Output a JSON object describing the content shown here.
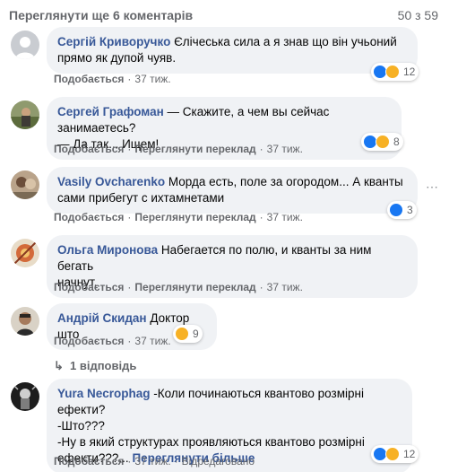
{
  "header": {
    "view_more": "Переглянути ще 6 коментарів",
    "count": "50 з 59"
  },
  "colors": {
    "author": "#385898",
    "bubble": "#f0f2f5",
    "meta": "#65676b",
    "like": "#1877f2",
    "haha": "#f7b125"
  },
  "actions": {
    "like": "Подобається",
    "translate": "Переглянути переклад",
    "week": "37 тиж.",
    "edited": "Відредаговано",
    "see_more": "Переглянути більше"
  },
  "comments": [
    {
      "author": "Сергій Криворучко",
      "text_lines": [
        "Єлічеська сила а я знав що він учьоний",
        "прямо як дупой чуяв."
      ],
      "reactions": {
        "icons": [
          "like-icon",
          "haha-icon"
        ],
        "count": "12"
      },
      "has_translate": false
    },
    {
      "author": "Сергей Графоман",
      "text_lines": [
        "— Скажите, а чем вы сейчас занимаетесь?",
        "— Да так... Ищем!"
      ],
      "reactions": {
        "icons": [
          "like-icon",
          "haha-icon"
        ],
        "count": "8"
      },
      "has_translate": true
    },
    {
      "author": "Vasily Ovcharenko",
      "text_lines": [
        "Морда есть, поле за огородом... А кванты",
        "сами прибегут с ихтамнетами"
      ],
      "reactions": {
        "icons": [
          "like-icon"
        ],
        "count": "3"
      },
      "has_translate": true
    },
    {
      "author": "Ольга Миронова",
      "text_lines": [
        "Набегается по полю, и кванты за ним бегать",
        "начнут."
      ],
      "reactions": null,
      "has_translate": true
    },
    {
      "author": "Андрій Скидан",
      "text_lines": [
        "Доктор што"
      ],
      "reactions": {
        "icons": [
          "haha-icon"
        ],
        "count": "9"
      },
      "has_translate": false,
      "replies": "1 відповідь"
    },
    {
      "author": "Yura Necrophag",
      "text_lines": [
        "-Коли починаються квантово розмірні ефекти?",
        "-Што???",
        "-Ну в який структурах проявляються квантово розмірні",
        "ефекти???..."
      ],
      "reactions": {
        "icons": [
          "like-icon",
          "haha-icon"
        ],
        "count": "12"
      },
      "has_translate": false,
      "edited": true
    }
  ]
}
